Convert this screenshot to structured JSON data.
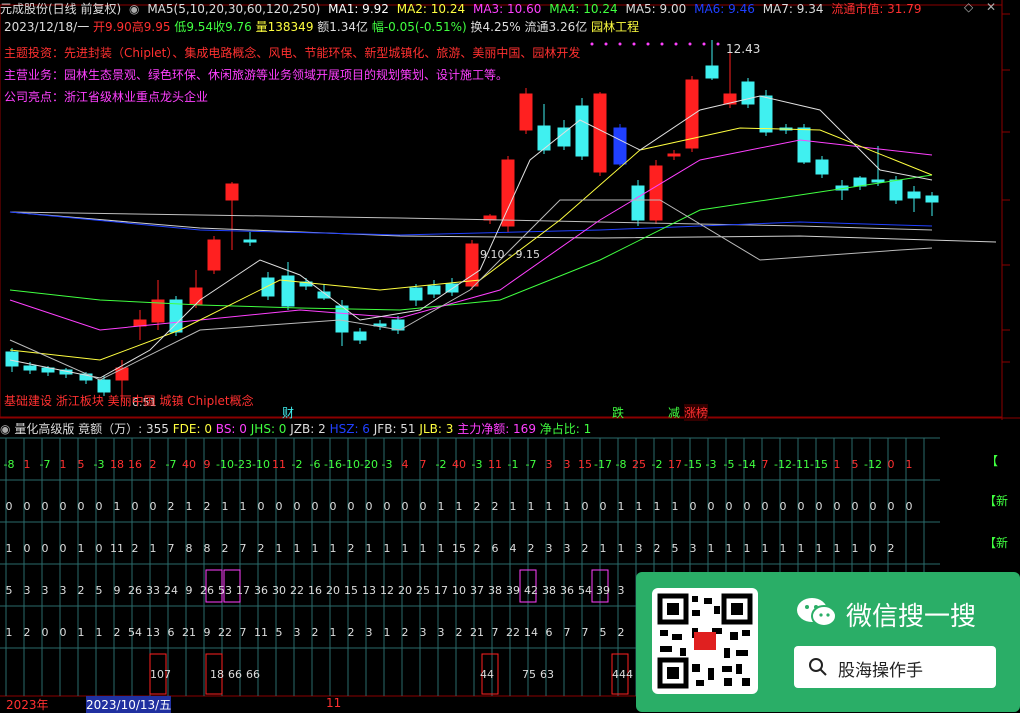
{
  "header": {
    "stock_name": "元成股份(日线 前复权)",
    "ma_params": "MA5(5,10,20,30,60,120,250)",
    "ma1": "MA1: 9.92",
    "ma2": "MA2: 10.24",
    "ma3": "MA3: 10.60",
    "ma4": "MA4: 10.24",
    "ma5": "MA5: 9.00",
    "ma6": "MA6: 9.46",
    "ma7": "MA7: 9.34",
    "market_value": "流通市值: 31.79"
  },
  "quote": {
    "date": "2023/12/18/一",
    "open": "开9.90",
    "high": "高9.95",
    "low": "低9.54",
    "close": "收9.76",
    "volume": "量138349",
    "amount": "额1.34亿",
    "change": "幅-0.05(-0.51%)",
    "turnover": "换4.25%",
    "float": "流通3.26亿",
    "sector": "园林工程"
  },
  "info": {
    "themes": "主题投资：先进封装（Chiplet）、集成电路概念、风电、节能环保、新型城镇化、旅游、美丽中国、园林开发",
    "business": "主营业务：园林生态景观、绿色环保、休闲旅游等业务领域开展项目的规划策划、设计施工等。",
    "highlight": "公司亮点：浙江省级林业重点龙头企业"
  },
  "annotations": {
    "peak": "12.43",
    "range": "9.10 - 9.15",
    "low": "6.51",
    "bottom_tags": "基础建设 浙江板块 美丽中国 城镇 Chiplet概念",
    "cai": "财",
    "die": "跌",
    "jian": "减",
    "zhangbang": "涨榜"
  },
  "indicator": {
    "title": "量化高级版",
    "jj": "竟额（万）: 355",
    "fde": "FDE: 0",
    "bs": "BS: 0",
    "jhs": "JHS: 0",
    "jzb": "JZB: 2",
    "hsz": "HSZ: 6",
    "jfb": "JFB: 51",
    "jlb": "JLB: 3",
    "zljy": "主力净额: 169",
    "jzb2": "净占比: 1"
  },
  "grid": {
    "row1": [
      "-8",
      "1",
      "-7",
      "1",
      "5",
      "-3",
      "18",
      "16",
      "2",
      "-7",
      "40",
      "9",
      "-10",
      "-23",
      "-10",
      "11",
      "-2",
      "-6",
      "-16",
      "-10",
      "-20",
      "-3",
      "4",
      "7",
      "-2",
      "40",
      "-3",
      "11",
      "-1",
      "-7",
      "3",
      "3",
      "15",
      "-17",
      "-8",
      "25",
      "-2",
      "17",
      "-15",
      "-3",
      "-5",
      "-14",
      "7",
      "-12",
      "-11",
      "-15",
      "1",
      "5",
      "-12",
      "0",
      "1"
    ],
    "row2": [
      "0",
      "0",
      "0",
      "0",
      "0",
      "0",
      "1",
      "0",
      "0",
      "2",
      "1",
      "2",
      "1",
      "1",
      "0",
      "0",
      "0",
      "0",
      "0",
      "0",
      "0",
      "0",
      "0",
      "0",
      "1",
      "1",
      "2",
      "2",
      "1",
      "1",
      "1",
      "1",
      "0",
      "0",
      "1",
      "1",
      "1",
      "1",
      "0",
      "0",
      "0",
      "0",
      "0",
      "0",
      "0",
      "0",
      "0",
      "0",
      "0",
      "0",
      "0"
    ],
    "row3": [
      "1",
      "0",
      "0",
      "0",
      "1",
      "0",
      "11",
      "2",
      "1",
      "7",
      "8",
      "8",
      "2",
      "7",
      "2",
      "1",
      "1",
      "1",
      "1",
      "2",
      "1",
      "1",
      "1",
      "1",
      "1",
      "15",
      "2",
      "6",
      "4",
      "2",
      "3",
      "3",
      "2",
      "1",
      "1",
      "3",
      "2",
      "5",
      "3",
      "1",
      "1",
      "1",
      "1",
      "1",
      "1",
      "1",
      "1",
      "1",
      "0",
      "2"
    ],
    "row4": [
      "5",
      "3",
      "3",
      "3",
      "2",
      "5",
      "9",
      "26",
      "33",
      "24",
      "9",
      "26",
      "53",
      "17",
      "36",
      "30",
      "22",
      "16",
      "20",
      "15",
      "13",
      "12",
      "20",
      "25",
      "17",
      "10",
      "37",
      "38",
      "39",
      "42",
      "38",
      "36",
      "54",
      "39",
      "3"
    ],
    "row5": [
      "1",
      "2",
      "0",
      "0",
      "1",
      "1",
      "2",
      "54",
      "13",
      "6",
      "21",
      "9",
      "22",
      "7",
      "11",
      "5",
      "3",
      "2",
      "1",
      "2",
      "3",
      "1",
      "2",
      "3",
      "3",
      "2",
      "21",
      "7",
      "22",
      "14",
      "6",
      "7",
      "7",
      "5",
      "2"
    ],
    "row6": [
      "107",
      "18",
      "66",
      "66",
      "44",
      "75",
      "63",
      "444"
    ]
  },
  "right_labels": [
    "【",
    "【新",
    "【新"
  ],
  "wechat": {
    "title": "微信搜一搜",
    "search_text": "股海操作手"
  },
  "bottom": {
    "year": "2023年",
    "date": "2023/10/13/五",
    "month": "11"
  },
  "colors": {
    "up": "#ff2020",
    "down": "#40f0f0",
    "blue": "#2040ff",
    "yellow": "#ffff40",
    "magenta": "#ff40ff",
    "green": "#40ff40",
    "white": "#e0e0e0",
    "grid": "#2a6a6a"
  }
}
